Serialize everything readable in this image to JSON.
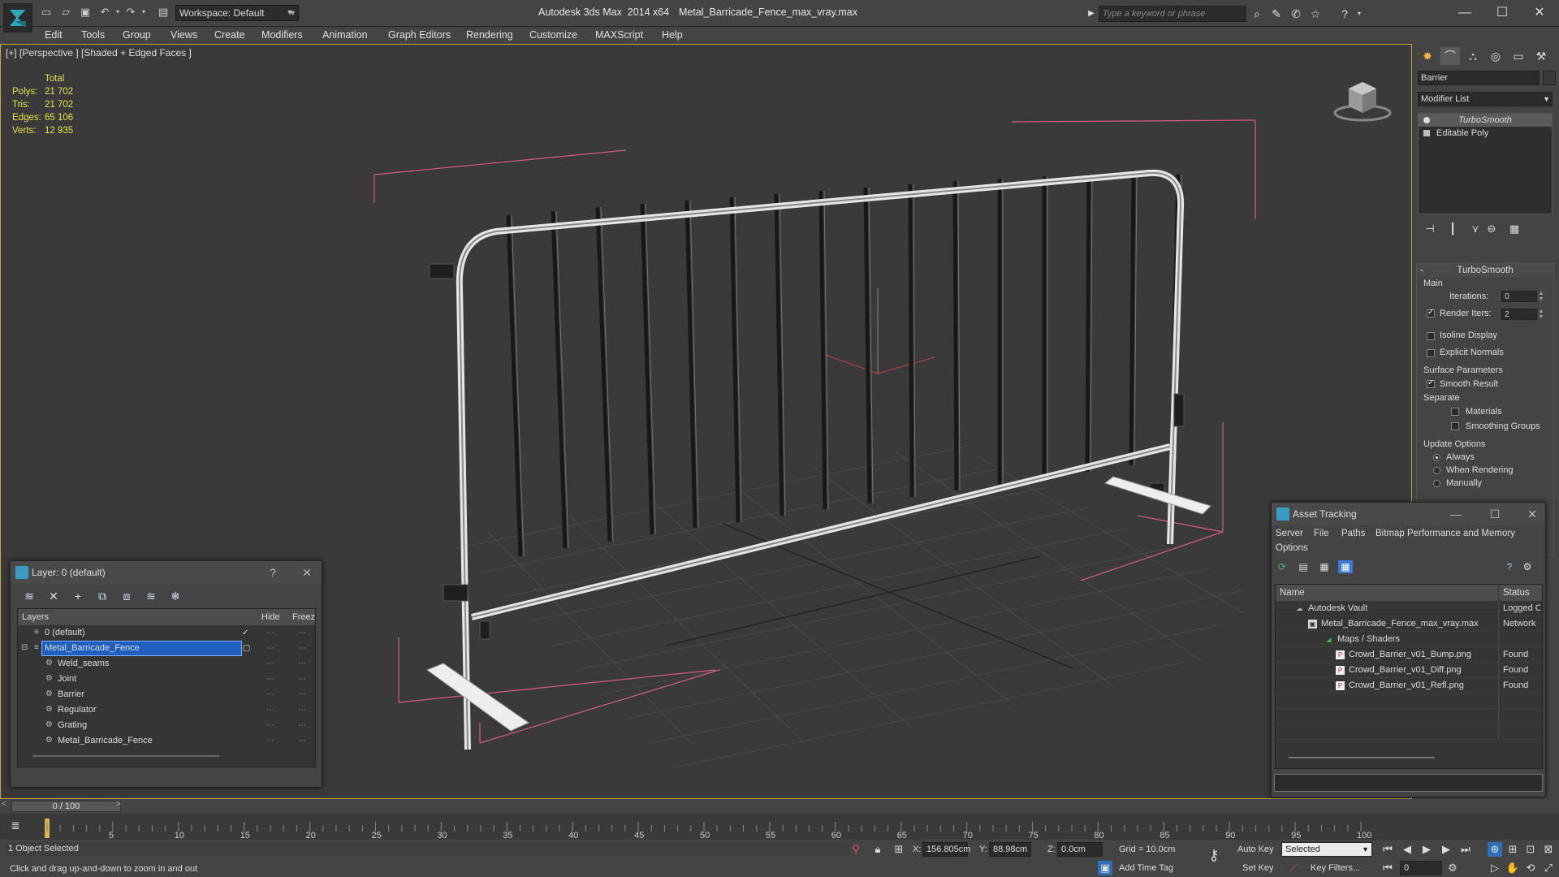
{
  "app": {
    "title": "Autodesk 3ds Max  2014 x64",
    "file": "Metal_Barricade_Fence_max_vray.max",
    "workspace": "Workspace: Default",
    "search_placeholder": "Type a keyword or phrase"
  },
  "menu": [
    "Edit",
    "Tools",
    "Group",
    "Views",
    "Create",
    "Modifiers",
    "Animation",
    "Graph Editors",
    "Rendering",
    "Customize",
    "MAXScript",
    "Help"
  ],
  "viewport": {
    "label": "[+] [Perspective ] [Shaded + Edged Faces ]",
    "stats": {
      "header": "Total",
      "rows": [
        {
          "label": "Polys:",
          "value": "21 702"
        },
        {
          "label": "Tris:",
          "value": "21 702"
        },
        {
          "label": "Edges:",
          "value": "65 106"
        },
        {
          "label": "Verts:",
          "value": "12 935"
        }
      ]
    }
  },
  "command_panel": {
    "object_name": "Barrier",
    "modifier_list": "Modifier List",
    "stack": [
      "TurboSmooth",
      "Editable Poly"
    ],
    "turbosmooth": {
      "title": "TurboSmooth",
      "main_label": "Main",
      "iterations_label": "Iterations:",
      "iterations_value": "0",
      "render_iters_label": "Render Iters:",
      "render_iters_value": "2",
      "isoline": "Isoline Display",
      "explicit_normals": "Explicit Normals",
      "surface_params": "Surface Parameters",
      "smooth_result": "Smooth Result",
      "separate": "Separate",
      "materials": "Materials",
      "smoothing_groups": "Smoothing Groups",
      "update_options": "Update Options",
      "always": "Always",
      "when_rendering": "When Rendering",
      "manually": "Manually"
    }
  },
  "layer_window": {
    "title": "Layer: 0 (default)",
    "help": "?",
    "columns": {
      "layers": "Layers",
      "hide": "Hide",
      "freeze": "Freez"
    },
    "rows": [
      {
        "name": "0 (default)",
        "level": 1,
        "kind": "layer"
      },
      {
        "name": "Metal_Barricade_Fence",
        "level": 1,
        "kind": "layer",
        "selected": true
      },
      {
        "name": "Weld_seams",
        "level": 2,
        "kind": "object"
      },
      {
        "name": "Joint",
        "level": 2,
        "kind": "object"
      },
      {
        "name": "Barrier",
        "level": 2,
        "kind": "object"
      },
      {
        "name": "Regulator",
        "level": 2,
        "kind": "object"
      },
      {
        "name": "Grating",
        "level": 2,
        "kind": "object"
      },
      {
        "name": "Metal_Barricade_Fence",
        "level": 2,
        "kind": "object"
      }
    ]
  },
  "asset_window": {
    "title": "Asset Tracking",
    "menu": [
      "Server",
      "File",
      "Paths",
      "Bitmap Performance and Memory",
      "Options"
    ],
    "columns": {
      "name": "Name",
      "status": "Status"
    },
    "rows": [
      {
        "name": "Autodesk Vault",
        "status": "Logged O",
        "level": 1,
        "icon": "vault"
      },
      {
        "name": "Metal_Barricade_Fence_max_vray.max",
        "status": "Network",
        "level": 2,
        "icon": "max"
      },
      {
        "name": "Maps / Shaders",
        "status": "",
        "level": 3,
        "icon": "maps"
      },
      {
        "name": "Crowd_Barrier_v01_Bump.png",
        "status": "Found",
        "level": 4,
        "icon": "png"
      },
      {
        "name": "Crowd_Barrier_v01_Diff.png",
        "status": "Found",
        "level": 4,
        "icon": "png"
      },
      {
        "name": "Crowd_Barrier_v01_Refl.png",
        "status": "Found",
        "level": 4,
        "icon": "png"
      }
    ]
  },
  "timeline": {
    "frame": "0 / 100",
    "ticks": [
      "5",
      "10",
      "15",
      "20",
      "25",
      "30",
      "35",
      "40",
      "45",
      "50",
      "55",
      "60",
      "65",
      "70",
      "75",
      "80",
      "85",
      "90",
      "95",
      "100"
    ]
  },
  "status": {
    "selection": "1 Object Selected",
    "prompt": "Click and drag up-and-down to zoom in and out",
    "x_label": "X:",
    "x": "156.805cm",
    "y_label": "Y:",
    "y": "88.98cm",
    "z_label": "Z:",
    "z": "0.0cm",
    "grid": "Grid = 10.0cm",
    "add_time_tag": "Add Time Tag",
    "auto_key": "Auto Key",
    "set_key": "Set Key",
    "selected": "Selected",
    "key_filters": "Key Filters...",
    "current_frame": "0"
  },
  "colors": {
    "accent": "#c8a545",
    "selection": "#1e5fbf",
    "stats": "#e8e04a",
    "bbox": "#d85a8a"
  }
}
